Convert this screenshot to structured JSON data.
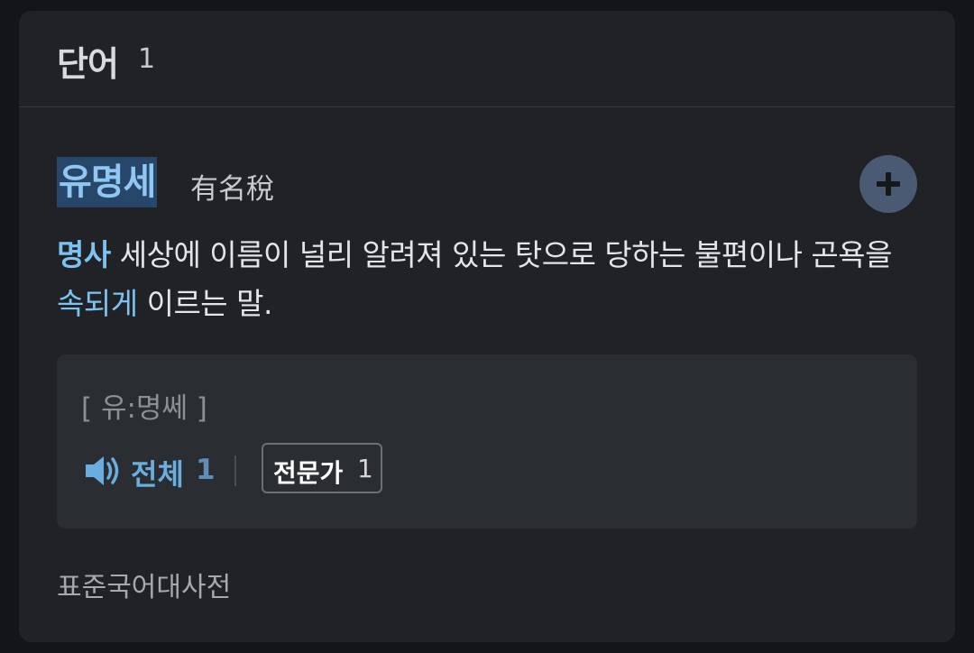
{
  "header": {
    "title": "단어",
    "count": "1"
  },
  "entry": {
    "headword": "유명세",
    "hanja": "有名稅",
    "add_icon": "plus-circle-icon",
    "definition": {
      "pos": "명사",
      "text_before": " 세상에 이름이 널리 알려져 있는 탓으로 당하는 불편이나 곤욕을 ",
      "link": "속되게",
      "text_after": " 이르는 말."
    },
    "pronunciation": {
      "text": "[ 유:명쎄 ]",
      "speaker_icon": "speaker-icon",
      "all_label": "전체",
      "all_count": "1",
      "expert_label": "전문가",
      "expert_count": "1"
    },
    "source": "표준국어대사전"
  },
  "colors": {
    "background": "#13151a",
    "card": "#202226",
    "accent": "#7cc3f2",
    "highlight": "#27476a"
  }
}
